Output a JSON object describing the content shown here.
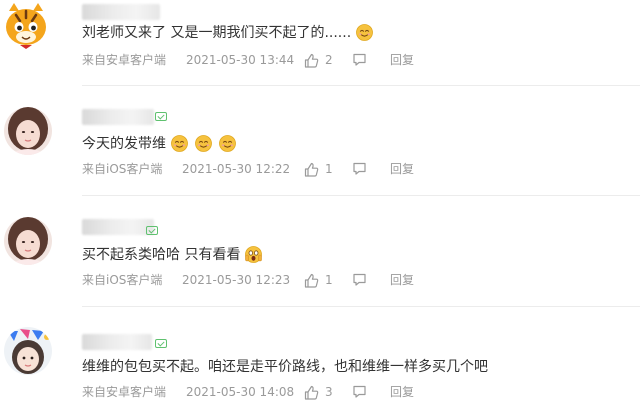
{
  "comments": [
    {
      "text": "刘老师又来了 又是一期我们买不起了的......",
      "emojis": [
        "smile-emoji"
      ],
      "source": "来自安卓客户端",
      "time": "2021-05-30 13:44",
      "likes": "2",
      "reply": "回复",
      "avatar": "tiger-cartoon"
    },
    {
      "text": "今天的发带维",
      "emojis": [
        "smile-emoji",
        "smile-emoji",
        "smile-emoji"
      ],
      "source": "来自iOS客户端",
      "time": "2021-05-30 12:22",
      "likes": "1",
      "reply": "回复",
      "avatar": "woman-photo"
    },
    {
      "text": "买不起系类哈哈 只有看看",
      "emojis": [
        "scared-emoji"
      ],
      "source": "来自iOS客户端",
      "time": "2021-05-30 12:23",
      "likes": "1",
      "reply": "回复",
      "avatar": "woman-photo"
    },
    {
      "text": "维维的包包买不起。咱还是走平价路线，也和维维一样多买几个吧",
      "emojis": [],
      "source": "来自安卓客户端",
      "time": "2021-05-30 14:08",
      "likes": "3",
      "reply": "回复",
      "avatar": "girl-sticker"
    }
  ],
  "colors": {
    "text": "#333333",
    "meta": "#9a9a9a",
    "badge": "#5fc16f",
    "emoji": "#f6c23e"
  }
}
